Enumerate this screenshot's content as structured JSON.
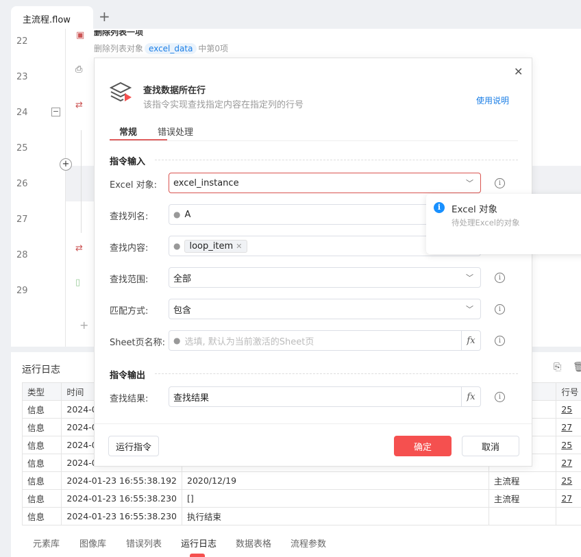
{
  "tabs": {
    "active": "主流程.flow",
    "add": "+"
  },
  "editor": {
    "line_numbers": [
      "22",
      "23",
      "24",
      "25",
      "26",
      "27",
      "28",
      "29"
    ],
    "step22_title": "删除列表一项",
    "step22_prefix": "删除列表对象",
    "step22_var": "excel_data",
    "step22_suffix": "中第0项"
  },
  "log": {
    "title": "运行日志",
    "headers": [
      "类型",
      "时间",
      "",
      "",
      "行号"
    ],
    "rows": [
      [
        "信息",
        "2024-0",
        "",
        "",
        "25"
      ],
      [
        "信息",
        "2024-0",
        "",
        "",
        "27"
      ],
      [
        "信息",
        "2024-0",
        "",
        "",
        "25"
      ],
      [
        "信息",
        "2024-0",
        "",
        "",
        "27"
      ],
      [
        "信息",
        "2024-01-23 16:55:38.192",
        "2020/12/19",
        "主流程",
        "25"
      ],
      [
        "信息",
        "2024-01-23 16:55:38.230",
        "[]",
        "主流程",
        "27"
      ],
      [
        "信息",
        "2024-01-23 16:55:38.230",
        "执行结束",
        "",
        ""
      ]
    ]
  },
  "bottom_tabs": [
    "元素库",
    "图像库",
    "错误列表",
    "运行日志",
    "数据表格",
    "流程参数"
  ],
  "modal": {
    "title": "查找数据所在行",
    "subtitle": "该指令实现查找指定内容在指定列的行号",
    "help": "使用说明",
    "tabs": [
      "常规",
      "错误处理"
    ],
    "input_section": "指令输入",
    "output_section": "指令输出",
    "fields": {
      "excel_label": "Excel 对象:",
      "excel_value": "excel_instance",
      "col_label": "查找列名:",
      "col_value": "A",
      "content_label": "查找内容:",
      "content_tag": "loop_item",
      "range_label": "查找范围:",
      "range_value": "全部",
      "match_label": "匹配方式:",
      "match_value": "包含",
      "sheet_label": "Sheet页名称:",
      "sheet_placeholder": "选填, 默认为当前激活的Sheet页",
      "result_label": "查找结果:",
      "result_value": "查找结果"
    },
    "run": "运行指令",
    "ok": "确定",
    "cancel": "取消"
  },
  "tooltip": {
    "title": "Excel 对象",
    "desc": "待处理Excel的对象"
  },
  "colors": {
    "accent": "#f5504f",
    "link": "#1a7ee6",
    "info": "#1890ff"
  }
}
